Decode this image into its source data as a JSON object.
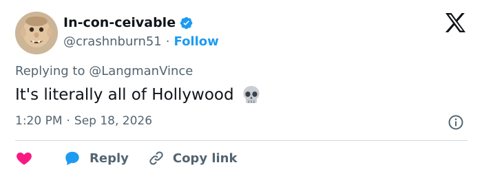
{
  "author": {
    "display_name": "In-con-ceivable",
    "handle": "@crashnburn51",
    "separator": "·",
    "follow_label": "Follow",
    "verified_color": "#1d9bf0"
  },
  "reply_context": {
    "prefix": "Replying to",
    "mention": "@LangmanVince"
  },
  "tweet": {
    "text": "It's literally all of Hollywood",
    "emoji": "skull-emoji"
  },
  "meta": {
    "time": "1:20 PM",
    "separator": "·",
    "date": "Sep 18, 2026"
  },
  "actions": {
    "reply_label": "Reply",
    "copy_link_label": "Copy link"
  },
  "colors": {
    "accent": "#1d9bf0",
    "like": "#f91880",
    "muted": "#536471",
    "text": "#0f1419"
  },
  "icons": [
    "x-logo-icon",
    "verified-badge-icon",
    "skull-emoji-icon",
    "info-icon",
    "heart-icon",
    "reply-bubble-icon",
    "link-icon"
  ]
}
